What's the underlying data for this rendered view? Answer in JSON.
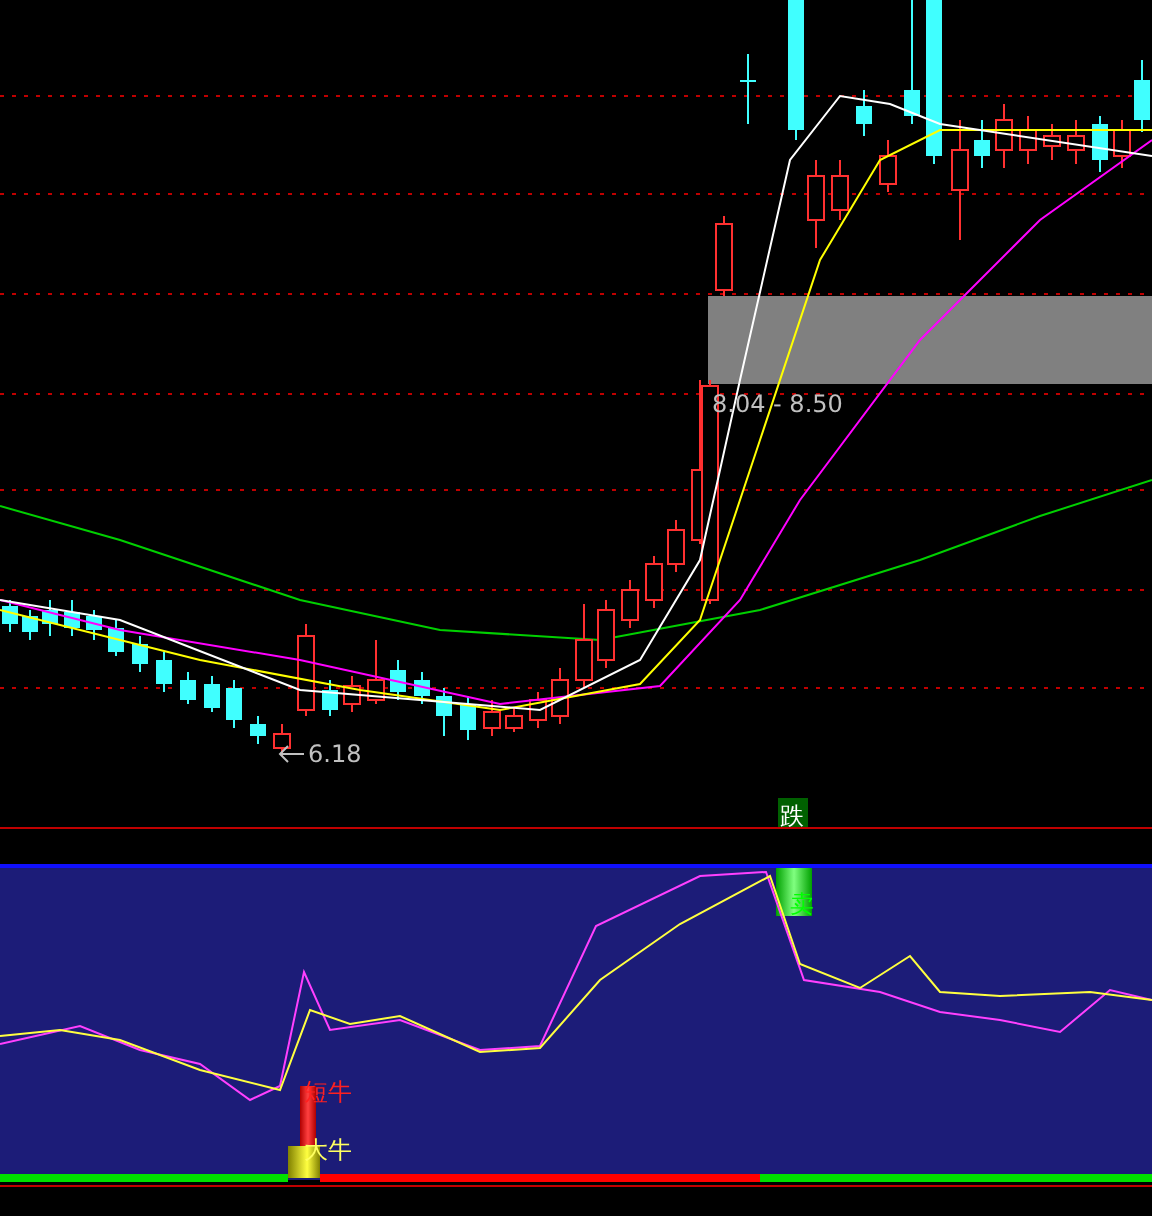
{
  "main_chart": {
    "range_label": "8.04 - 8.50",
    "low_label": "6.18",
    "signal_label": "跌"
  },
  "indicator": {
    "sell_label": "卖",
    "labels": [
      "短牛",
      "大牛"
    ]
  }
}
